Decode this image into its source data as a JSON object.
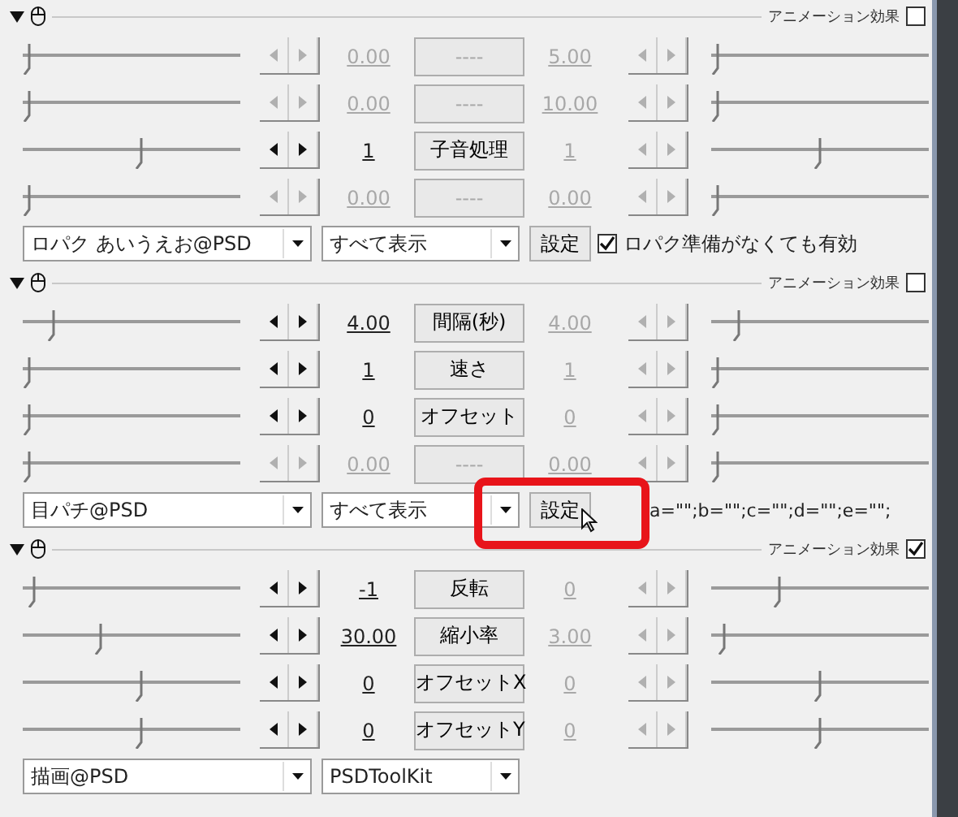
{
  "sections": [
    {
      "animation_label": "アニメーション効果",
      "animation_checked": false,
      "rows": [
        {
          "start": "0.00",
          "button": "----",
          "end": "5.00",
          "disabled": true,
          "end_disabled": true,
          "start_slider": {
            "level": 0
          },
          "end_slider": {
            "level": 0
          }
        },
        {
          "start": "0.00",
          "button": "----",
          "end": "10.00",
          "disabled": true,
          "end_disabled": true,
          "start_slider": {
            "level": 0
          },
          "end_slider": {
            "level": 0
          }
        },
        {
          "start": "1",
          "button": "子音処理",
          "end": "1",
          "disabled": false,
          "end_disabled": true,
          "start_slider": {
            "level": 0.55
          },
          "end_slider": {
            "level": 0.5
          }
        },
        {
          "start": "0.00",
          "button": "----",
          "end": "0.00",
          "disabled": true,
          "end_disabled": true,
          "start_slider": {
            "level": 0
          },
          "end_slider": {
            "level": 0
          }
        }
      ],
      "combo_row": {
        "effect": "ロパク あいうえお@PSD",
        "mode": "すべて表示",
        "settings_button": {
          "label": "設定",
          "highlighted": false
        },
        "checkbox": {
          "label": "ロパク準備がなくても有効",
          "checked": true
        }
      }
    },
    {
      "animation_label": "アニメーション効果",
      "animation_checked": false,
      "rows": [
        {
          "start": "4.00",
          "button": "間隔(秒)",
          "end": "4.00",
          "disabled": false,
          "end_disabled": true,
          "start_slider": {
            "level": 0.12
          },
          "end_slider": {
            "level": 0.1
          }
        },
        {
          "start": "1",
          "button": "速さ",
          "end": "1",
          "disabled": false,
          "end_disabled": true,
          "start_slider": {
            "level": 0
          },
          "end_slider": {
            "level": 0
          }
        },
        {
          "start": "0",
          "button": "オフセット",
          "end": "0",
          "disabled": false,
          "end_disabled": true,
          "start_slider": {
            "level": 0
          },
          "end_slider": {
            "level": 0
          }
        },
        {
          "start": "0.00",
          "button": "----",
          "end": "0.00",
          "disabled": true,
          "end_disabled": true,
          "start_slider": {
            "level": 0
          },
          "end_slider": {
            "level": 0
          }
        }
      ],
      "combo_row": {
        "effect": "目パチ@PSD",
        "mode": "すべて表示",
        "settings_button": {
          "label": "設定",
          "highlighted": true
        },
        "params_text": "a=\"\";b=\"\";c=\"\";d=\"\";e=\"\";"
      }
    },
    {
      "animation_label": "アニメーション効果",
      "animation_checked": true,
      "rows": [
        {
          "start": "-1",
          "button": "反転",
          "end": "0",
          "disabled": false,
          "end_disabled": true,
          "start_slider": {
            "level": 0.02
          },
          "end_slider": {
            "level": 0.3
          }
        },
        {
          "start": "30.00",
          "button": "縮小率",
          "end": "3.00",
          "disabled": false,
          "end_disabled": true,
          "start_slider": {
            "level": 0.35
          },
          "end_slider": {
            "level": 0.03
          }
        },
        {
          "start": "0",
          "button": "オフセットX",
          "end": "0",
          "disabled": false,
          "end_disabled": true,
          "start_slider": {
            "level": 0.55
          },
          "end_slider": {
            "level": 0.5
          }
        },
        {
          "start": "0",
          "button": "オフセットY",
          "end": "0",
          "disabled": false,
          "end_disabled": true,
          "start_slider": {
            "level": 0.55
          },
          "end_slider": {
            "level": 0.5
          }
        }
      ],
      "combo_row": {
        "effect": "描画@PSD",
        "mode": "PSDToolKit"
      }
    }
  ]
}
